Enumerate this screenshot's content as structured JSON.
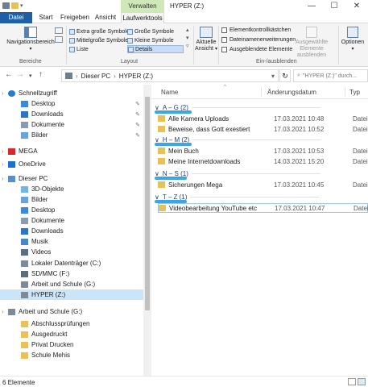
{
  "window": {
    "title": "HYPER (Z:)",
    "controls": {
      "minimize": "—",
      "maximize": "☐",
      "close": "✕"
    }
  },
  "ribbon": {
    "context_header": "Verwalten",
    "tabs": [
      "Datei",
      "Start",
      "Freigeben",
      "Ansicht",
      "Laufwerktools"
    ],
    "groups": {
      "panes": {
        "label": "Bereiche",
        "nav_pane": "Navigationsbereich"
      },
      "layout": {
        "label": "Layout",
        "options": [
          "Extra große Symbole",
          "Große Symbole",
          "Mittelgroße Symbole",
          "Kleine Symbole",
          "Liste",
          "Details"
        ]
      },
      "current_view": {
        "label": "Aktuelle Ansicht"
      },
      "show_hide": {
        "label": "Ein-/ausblenden",
        "checkboxes": [
          "Elementkontrollkästchen",
          "Dateinamenerweiterungen",
          "Ausgeblendete Elemente"
        ],
        "hide_selected": "Ausgewählte Elemente ausblenden"
      },
      "options": {
        "label": "Optionen"
      }
    }
  },
  "address": {
    "path": [
      "Dieser PC",
      "HYPER (Z:)"
    ],
    "search_placeholder": "\"HYPER (Z:)\" durch..."
  },
  "sidebar": {
    "items": [
      {
        "label": "Schnellzugriff",
        "level": 0,
        "icon": "star-icon",
        "color": "#2b78d6"
      },
      {
        "label": "Desktop",
        "level": 1,
        "icon": "desktop-icon",
        "color": "#3b8ad9",
        "pinned": true
      },
      {
        "label": "Downloads",
        "level": 1,
        "icon": "download-icon",
        "color": "#2d74c9",
        "pinned": true
      },
      {
        "label": "Dokumente",
        "level": 1,
        "icon": "documents-icon",
        "color": "#8a9bb0",
        "pinned": true
      },
      {
        "label": "Bilder",
        "level": 1,
        "icon": "pictures-icon",
        "color": "#6aa3d8",
        "pinned": true
      },
      {
        "label": "MEGA",
        "level": 0,
        "icon": "mega-icon",
        "color": "#d9272e"
      },
      {
        "label": "OneDrive",
        "level": 0,
        "icon": "cloud-icon",
        "color": "#1f6fd1"
      },
      {
        "label": "Dieser PC",
        "level": 0,
        "icon": "computer-icon",
        "color": "#5a8fc9"
      },
      {
        "label": "3D-Objekte",
        "level": 1,
        "icon": "3d-objects-icon",
        "color": "#6fb7e6"
      },
      {
        "label": "Bilder",
        "level": 1,
        "icon": "pictures-icon",
        "color": "#6aa3d8"
      },
      {
        "label": "Desktop",
        "level": 1,
        "icon": "desktop-icon",
        "color": "#3b8ad9"
      },
      {
        "label": "Dokumente",
        "level": 1,
        "icon": "documents-icon",
        "color": "#8a9bb0"
      },
      {
        "label": "Downloads",
        "level": 1,
        "icon": "download-icon",
        "color": "#2d74c9"
      },
      {
        "label": "Musik",
        "level": 1,
        "icon": "music-icon",
        "color": "#4a86c8"
      },
      {
        "label": "Videos",
        "level": 1,
        "icon": "videos-icon",
        "color": "#5b6e88"
      },
      {
        "label": "Lokaler Datenträger (C:)",
        "level": 1,
        "icon": "drive-icon",
        "color": "#7d8b99"
      },
      {
        "label": "SD/MMC (F:)",
        "level": 1,
        "icon": "sd-card-icon",
        "color": "#5d6b7a"
      },
      {
        "label": "Arbeit und Schule (G:)",
        "level": 1,
        "icon": "drive-icon",
        "color": "#7d8b99"
      },
      {
        "label": "HYPER (Z:)",
        "level": 1,
        "icon": "drive-icon",
        "color": "#7d8b99",
        "selected": true
      },
      {
        "label": "Arbeit und Schule (G:)",
        "level": 0,
        "icon": "drive-icon",
        "color": "#7d8b99"
      },
      {
        "label": "Abschlussprüfungen",
        "level": 1,
        "icon": "folder-icon",
        "color": "#e8c15a"
      },
      {
        "label": "Ausgedruckt",
        "level": 1,
        "icon": "folder-icon",
        "color": "#e8c15a"
      },
      {
        "label": "Privat Drucken",
        "level": 1,
        "icon": "folder-icon",
        "color": "#e8c15a"
      },
      {
        "label": "Schule Mehis",
        "level": 1,
        "icon": "folder-icon",
        "color": "#e8c15a"
      }
    ]
  },
  "content": {
    "columns": [
      "Name",
      "Änderungsdatum",
      "Typ"
    ],
    "groups": [
      {
        "header": "A – G (2)",
        "files": [
          {
            "name": "Alle Kamera Uploads",
            "date": "17.03.2021 10:48",
            "type": "Dateio"
          },
          {
            "name": "Beweise, dass Gott exestiert",
            "date": "17.03.2021 10:52",
            "type": "Dateio"
          }
        ]
      },
      {
        "header": "H – M (2)",
        "files": [
          {
            "name": "Mein Buch",
            "date": "17.03.2021 10:53",
            "type": "Dateio"
          },
          {
            "name": "Meine Internetdownloads",
            "date": "14.03.2021 15:20",
            "type": "Dateio"
          }
        ]
      },
      {
        "header": "N – S (1)",
        "files": [
          {
            "name": "Sicherungen Mega",
            "date": "17.03.2021 10:45",
            "type": "Dateio"
          }
        ]
      },
      {
        "header": "T – Z (1)",
        "files": [
          {
            "name": "Videobearbeitung YouTube etc",
            "date": "17.03.2021 10:47",
            "type": "Dateio",
            "selected": true
          }
        ]
      }
    ]
  },
  "status": {
    "count": "6 Elemente"
  },
  "colors": {
    "accent": "#1f5fa8",
    "context_tab": "#cfe8b8",
    "marker": "#3ba6e6",
    "folder": "#e8c15a",
    "selection": "#cce4f7"
  }
}
